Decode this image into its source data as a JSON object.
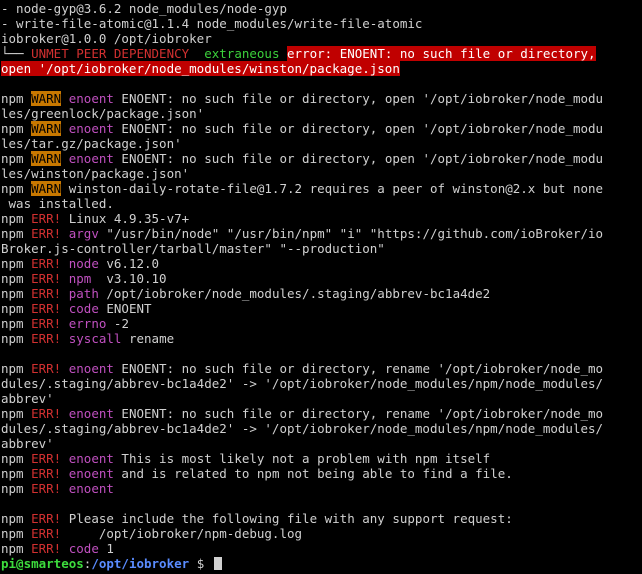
{
  "terminal": {
    "lines": [
      [
        {
          "t": "- node-gyp@3.6.2 node_modules/node-gyp",
          "c": "white"
        }
      ],
      [
        {
          "t": "- write-file-atomic@1.1.4 node_modules/write-file-atomic",
          "c": "white"
        }
      ],
      [
        {
          "t": "iobroker@1.0.0 /opt/iobroker",
          "c": "white"
        }
      ],
      [
        {
          "t": "└── ",
          "c": "white"
        },
        {
          "t": "UNMET PEER DEPENDENCY",
          "c": "red"
        },
        {
          "t": "  ",
          "c": "white"
        },
        {
          "t": "extraneous",
          "c": "green"
        },
        {
          "t": " ",
          "c": "white"
        },
        {
          "t": "error: ENOENT: no such file or directory,",
          "c": "errbar"
        }
      ],
      [
        {
          "t": "open '/opt/iobroker/node_modules/winston/package.json",
          "c": "errbar"
        }
      ],
      [],
      [
        {
          "t": "npm ",
          "c": "white"
        },
        {
          "t": "WARN",
          "c": "warnbg"
        },
        {
          "t": " ",
          "c": "white"
        },
        {
          "t": "enoent",
          "c": "magenta"
        },
        {
          "t": " ENOENT: no such file or directory, open '/opt/iobroker/node_modu",
          "c": "white"
        }
      ],
      [
        {
          "t": "les/greenlock/package.json'",
          "c": "white"
        }
      ],
      [
        {
          "t": "npm ",
          "c": "white"
        },
        {
          "t": "WARN",
          "c": "warnbg"
        },
        {
          "t": " ",
          "c": "white"
        },
        {
          "t": "enoent",
          "c": "magenta"
        },
        {
          "t": " ENOENT: no such file or directory, open '/opt/iobroker/node_modu",
          "c": "white"
        }
      ],
      [
        {
          "t": "les/tar.gz/package.json'",
          "c": "white"
        }
      ],
      [
        {
          "t": "npm ",
          "c": "white"
        },
        {
          "t": "WARN",
          "c": "warnbg"
        },
        {
          "t": " ",
          "c": "white"
        },
        {
          "t": "enoent",
          "c": "magenta"
        },
        {
          "t": " ENOENT: no such file or directory, open '/opt/iobroker/node_modu",
          "c": "white"
        }
      ],
      [
        {
          "t": "les/winston/package.json'",
          "c": "white"
        }
      ],
      [
        {
          "t": "npm ",
          "c": "white"
        },
        {
          "t": "WARN",
          "c": "warnbg"
        },
        {
          "t": " winston-daily-rotate-file@1.7.2 requires a peer of winston@2.x but none",
          "c": "white"
        }
      ],
      [
        {
          "t": " was installed.",
          "c": "white"
        }
      ],
      [
        {
          "t": "npm ",
          "c": "white"
        },
        {
          "t": "ERR!",
          "c": "red"
        },
        {
          "t": " Linux 4.9.35-v7+",
          "c": "white"
        }
      ],
      [
        {
          "t": "npm ",
          "c": "white"
        },
        {
          "t": "ERR!",
          "c": "red"
        },
        {
          "t": " ",
          "c": "white"
        },
        {
          "t": "argv",
          "c": "magenta"
        },
        {
          "t": " \"/usr/bin/node\" \"/usr/bin/npm\" \"i\" \"https://github.com/ioBroker/io",
          "c": "white"
        }
      ],
      [
        {
          "t": "Broker.js-controller/tarball/master\" \"--production\"",
          "c": "white"
        }
      ],
      [
        {
          "t": "npm ",
          "c": "white"
        },
        {
          "t": "ERR!",
          "c": "red"
        },
        {
          "t": " ",
          "c": "white"
        },
        {
          "t": "node",
          "c": "magenta"
        },
        {
          "t": " v6.12.0",
          "c": "white"
        }
      ],
      [
        {
          "t": "npm ",
          "c": "white"
        },
        {
          "t": "ERR!",
          "c": "red"
        },
        {
          "t": " ",
          "c": "white"
        },
        {
          "t": "npm",
          "c": "magenta"
        },
        {
          "t": "  v3.10.10",
          "c": "white"
        }
      ],
      [
        {
          "t": "npm ",
          "c": "white"
        },
        {
          "t": "ERR!",
          "c": "red"
        },
        {
          "t": " ",
          "c": "white"
        },
        {
          "t": "path",
          "c": "magenta"
        },
        {
          "t": " /opt/iobroker/node_modules/.staging/abbrev-bc1a4de2",
          "c": "white"
        }
      ],
      [
        {
          "t": "npm ",
          "c": "white"
        },
        {
          "t": "ERR!",
          "c": "red"
        },
        {
          "t": " ",
          "c": "white"
        },
        {
          "t": "code",
          "c": "magenta"
        },
        {
          "t": " ENOENT",
          "c": "white"
        }
      ],
      [
        {
          "t": "npm ",
          "c": "white"
        },
        {
          "t": "ERR!",
          "c": "red"
        },
        {
          "t": " ",
          "c": "white"
        },
        {
          "t": "errno",
          "c": "magenta"
        },
        {
          "t": " -2",
          "c": "white"
        }
      ],
      [
        {
          "t": "npm ",
          "c": "white"
        },
        {
          "t": "ERR!",
          "c": "red"
        },
        {
          "t": " ",
          "c": "white"
        },
        {
          "t": "syscall",
          "c": "magenta"
        },
        {
          "t": " rename",
          "c": "white"
        }
      ],
      [],
      [
        {
          "t": "npm ",
          "c": "white"
        },
        {
          "t": "ERR!",
          "c": "red"
        },
        {
          "t": " ",
          "c": "white"
        },
        {
          "t": "enoent",
          "c": "magenta"
        },
        {
          "t": " ENOENT: no such file or directory, rename '/opt/iobroker/node_mo",
          "c": "white"
        }
      ],
      [
        {
          "t": "dules/.staging/abbrev-bc1a4de2' -> '/opt/iobroker/node_modules/npm/node_modules/",
          "c": "white"
        }
      ],
      [
        {
          "t": "abbrev'",
          "c": "white"
        }
      ],
      [
        {
          "t": "npm ",
          "c": "white"
        },
        {
          "t": "ERR!",
          "c": "red"
        },
        {
          "t": " ",
          "c": "white"
        },
        {
          "t": "enoent",
          "c": "magenta"
        },
        {
          "t": " ENOENT: no such file or directory, rename '/opt/iobroker/node_mo",
          "c": "white"
        }
      ],
      [
        {
          "t": "dules/.staging/abbrev-bc1a4de2' -> '/opt/iobroker/node_modules/npm/node_modules/",
          "c": "white"
        }
      ],
      [
        {
          "t": "abbrev'",
          "c": "white"
        }
      ],
      [
        {
          "t": "npm ",
          "c": "white"
        },
        {
          "t": "ERR!",
          "c": "red"
        },
        {
          "t": " ",
          "c": "white"
        },
        {
          "t": "enoent",
          "c": "magenta"
        },
        {
          "t": " This is most likely not a problem with npm itself",
          "c": "white"
        }
      ],
      [
        {
          "t": "npm ",
          "c": "white"
        },
        {
          "t": "ERR!",
          "c": "red"
        },
        {
          "t": " ",
          "c": "white"
        },
        {
          "t": "enoent",
          "c": "magenta"
        },
        {
          "t": " and is related to npm not being able to find a file.",
          "c": "white"
        }
      ],
      [
        {
          "t": "npm ",
          "c": "white"
        },
        {
          "t": "ERR!",
          "c": "red"
        },
        {
          "t": " ",
          "c": "white"
        },
        {
          "t": "enoent",
          "c": "magenta"
        }
      ],
      [],
      [
        {
          "t": "npm ",
          "c": "white"
        },
        {
          "t": "ERR!",
          "c": "red"
        },
        {
          "t": " Please include the following file with any support request:",
          "c": "white"
        }
      ],
      [
        {
          "t": "npm ",
          "c": "white"
        },
        {
          "t": "ERR!",
          "c": "red"
        },
        {
          "t": "     /opt/iobroker/npm-debug.log",
          "c": "white"
        }
      ],
      [
        {
          "t": "npm ",
          "c": "white"
        },
        {
          "t": "ERR!",
          "c": "red"
        },
        {
          "t": " ",
          "c": "white"
        },
        {
          "t": "code",
          "c": "magenta"
        },
        {
          "t": " 1",
          "c": "white"
        }
      ]
    ],
    "prompt": {
      "user_host": "pi@smarteos",
      "separator": ":",
      "path": "/opt/iobroker",
      "symbol": " $ "
    }
  }
}
